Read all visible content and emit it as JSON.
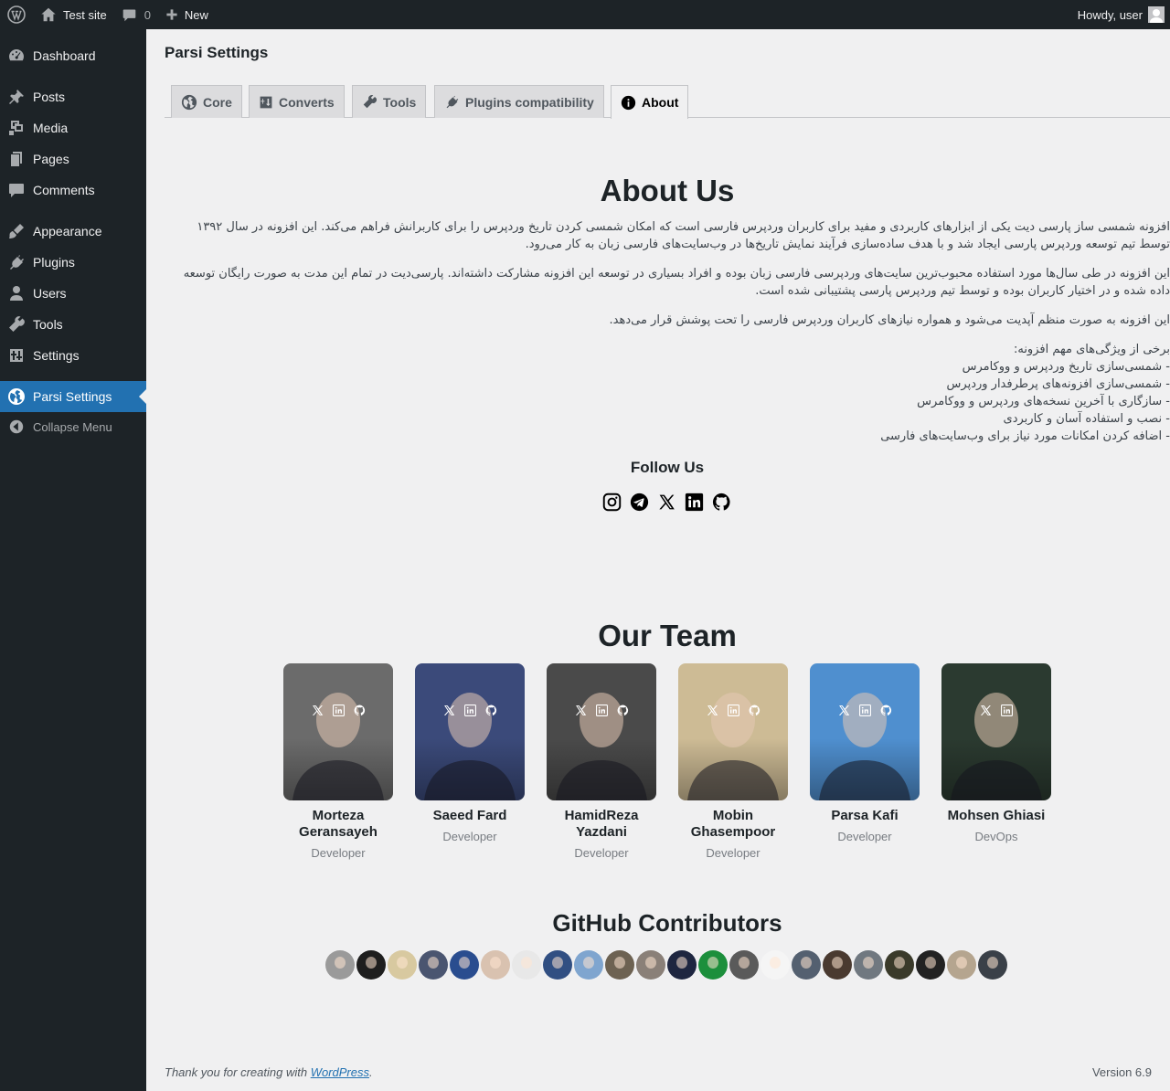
{
  "adminbar": {
    "site_name": "Test site",
    "comments_count": "0",
    "new_label": "New",
    "howdy": "Howdy, user"
  },
  "sidebar": {
    "items": [
      {
        "label": "Dashboard",
        "icon": "dashboard-icon"
      },
      {
        "label": "Posts",
        "icon": "pin-icon"
      },
      {
        "label": "Media",
        "icon": "media-icon"
      },
      {
        "label": "Pages",
        "icon": "pages-icon"
      },
      {
        "label": "Comments",
        "icon": "comment-icon"
      },
      {
        "label": "Appearance",
        "icon": "brush-icon"
      },
      {
        "label": "Plugins",
        "icon": "plug-icon"
      },
      {
        "label": "Users",
        "icon": "user-icon"
      },
      {
        "label": "Tools",
        "icon": "wrench-icon"
      },
      {
        "label": "Settings",
        "icon": "settings-icon"
      },
      {
        "label": "Parsi Settings",
        "icon": "globe-icon"
      }
    ],
    "collapse_label": "Collapse Menu"
  },
  "page": {
    "title": "Parsi Settings",
    "tabs": [
      {
        "label": "Core",
        "icon": "globe-icon"
      },
      {
        "label": "Converts",
        "icon": "convert-icon"
      },
      {
        "label": "Tools",
        "icon": "wrench-icon"
      },
      {
        "label": "Plugins compatibility",
        "icon": "plug-icon"
      },
      {
        "label": "About",
        "icon": "info-icon"
      }
    ]
  },
  "about": {
    "title": "About Us",
    "para1": "افزونه شمسی ساز پارسی دیت یکی از ابزارهای کاربردی و مفید برای کاربران وردپرس فارسی است که امکان شمسی کردن تاریخ وردپرس را برای کاربرانش فراهم می‌کند. این افزونه در سال ۱۳۹۲ توسط تیم توسعه وردپرس پارسی ایجاد شد و با هدف ساده‌سازی فرآیند نمایش تاریخ‌ها در وب‌سایت‌های فارسی زبان به کار می‌رود.",
    "para2": "این افزونه در طی سال‌ها مورد استفاده محبوب‌ترین سایت‌های وردپرسی فارسی زبان بوده و افراد بسیاری در توسعه این افزونه مشارکت داشته‌اند. پارسی‌دیت در تمام این مدت به صورت رایگان توسعه داده شده و در اختیار کاربران بوده و توسط تیم وردپرس پارسی پشتیبانی شده است.",
    "para3": "این افزونه به صورت منظم آپدیت می‌شود و همواره نیازهای کاربران وردپرس فارسی را تحت پوشش قرار می‌دهد.",
    "features_title": "برخی از ویژگی‌های مهم افزونه:",
    "features": [
      "- شمسی‌سازی تاریخ وردپرس و ووکامرس",
      "- شمسی‌سازی افزونه‌های پرطرفدار وردپرس",
      "- سازگاری با آخرین نسخه‌های وردپرس و ووکامرس",
      "- نصب و استفاده آسان و کاربردی",
      "- اضافه کردن امکانات مورد نیاز برای وب‌سایت‌های فارسی"
    ],
    "follow_title": "Follow Us",
    "social_icons": [
      "instagram-icon",
      "telegram-icon",
      "x-icon",
      "linkedin-icon",
      "github-icon"
    ]
  },
  "team": {
    "title": "Our Team",
    "members": [
      {
        "name": "Morteza Geransayeh",
        "role": "Developer",
        "color": "#6b6b6b",
        "links": [
          "x-icon",
          "linkedin-icon",
          "github-icon"
        ]
      },
      {
        "name": "Saeed Fard",
        "role": "Developer",
        "color": "#3b4a7a",
        "links": [
          "x-icon",
          "linkedin-icon",
          "github-icon"
        ]
      },
      {
        "name": "HamidReza Yazdani",
        "role": "Developer",
        "color": "#4a4a4a",
        "links": [
          "x-icon",
          "linkedin-icon",
          "github-icon"
        ]
      },
      {
        "name": "Mobin Ghasempoor",
        "role": "Developer",
        "color": "#cdbb95",
        "links": [
          "x-icon",
          "linkedin-icon",
          "github-icon"
        ]
      },
      {
        "name": "Parsa Kafi",
        "role": "Developer",
        "color": "#4f8fcf",
        "links": [
          "x-icon",
          "linkedin-icon",
          "github-icon"
        ]
      },
      {
        "name": "Mohsen Ghiasi",
        "role": "DevOps",
        "color": "#2b3a30",
        "links": [
          "x-icon",
          "linkedin-icon"
        ]
      }
    ]
  },
  "contributors": {
    "title": "GitHub Contributors",
    "avatars": [
      "#9a9a9a",
      "#1e1e1e",
      "#d8c9a0",
      "#4a5570",
      "#2a4d8f",
      "#d9c2b0",
      "#e8e8e8",
      "#314f82",
      "#7fa5cf",
      "#6d6252",
      "#8a8078",
      "#1e2640",
      "#1c8f3c",
      "#5a5a5a",
      "#f5f5f5",
      "#546070",
      "#4a3a30",
      "#707880",
      "#3a3a2a",
      "#222222",
      "#b5a58f",
      "#3a4048"
    ]
  },
  "footer": {
    "thanks_prefix": "Thank you for creating with ",
    "thanks_link": "WordPress",
    "thanks_suffix": ".",
    "version": "Version 6.9"
  }
}
